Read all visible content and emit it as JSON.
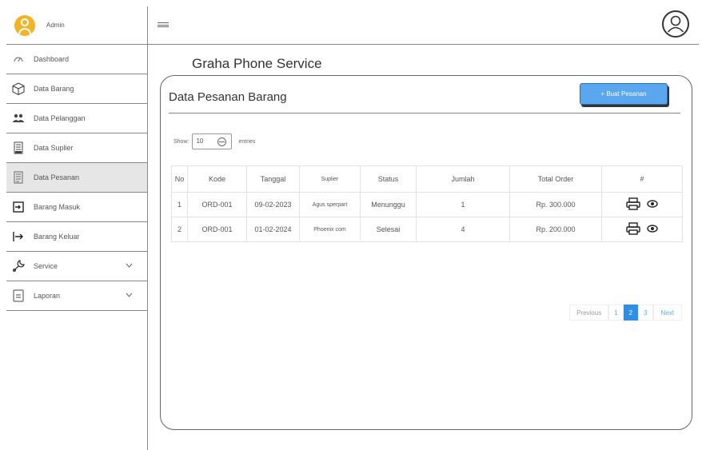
{
  "sidebar": {
    "admin_label": "Admin",
    "items": [
      {
        "label": "Dashboard",
        "icon": "dashboard-icon"
      },
      {
        "label": "Data Barang",
        "icon": "box-icon"
      },
      {
        "label": "Data Pelanggan",
        "icon": "users-icon"
      },
      {
        "label": "Data Suplier",
        "icon": "building-icon"
      },
      {
        "label": "Data Pesanan",
        "icon": "document-icon",
        "active": true
      },
      {
        "label": "Barang Masuk",
        "icon": "login-icon"
      },
      {
        "label": "Barang Keluar",
        "icon": "logout-icon"
      },
      {
        "label": "Service",
        "icon": "wrench-icon",
        "expandable": true
      },
      {
        "label": "Laporan",
        "icon": "report-icon",
        "expandable": true
      }
    ]
  },
  "page": {
    "title": "Graha Phone Service",
    "card_title": "Data Pesanan Barang",
    "new_button": "+ Buat Pesanan"
  },
  "controls": {
    "show_label": "Show",
    "entries_value": "10",
    "entries_label": "entries"
  },
  "table": {
    "headers": [
      "No",
      "Kode",
      "Tanggal",
      "Suplier",
      "Status",
      "Jumlah",
      "Total Order",
      "#"
    ],
    "rows": [
      {
        "no": "1",
        "kode": "ORD-001",
        "tanggal": "09-02-2023",
        "suplier": "Agus sperpart",
        "status": "Menunggu",
        "jumlah": "1",
        "total": "Rp. 300.000"
      },
      {
        "no": "2",
        "kode": "ORD-001",
        "tanggal": "01-02-2024",
        "suplier": "Phoenix com",
        "status": "Selesai",
        "jumlah": "4",
        "total": "Rp. 200.000"
      }
    ]
  },
  "pagination": {
    "previous": "Previous",
    "pages": [
      "1",
      "2",
      "3"
    ],
    "current": "2",
    "next": "Next"
  },
  "colors": {
    "accent": "#2f8fe6",
    "button": "#5aa7ef",
    "avatar": "#f0b429"
  }
}
